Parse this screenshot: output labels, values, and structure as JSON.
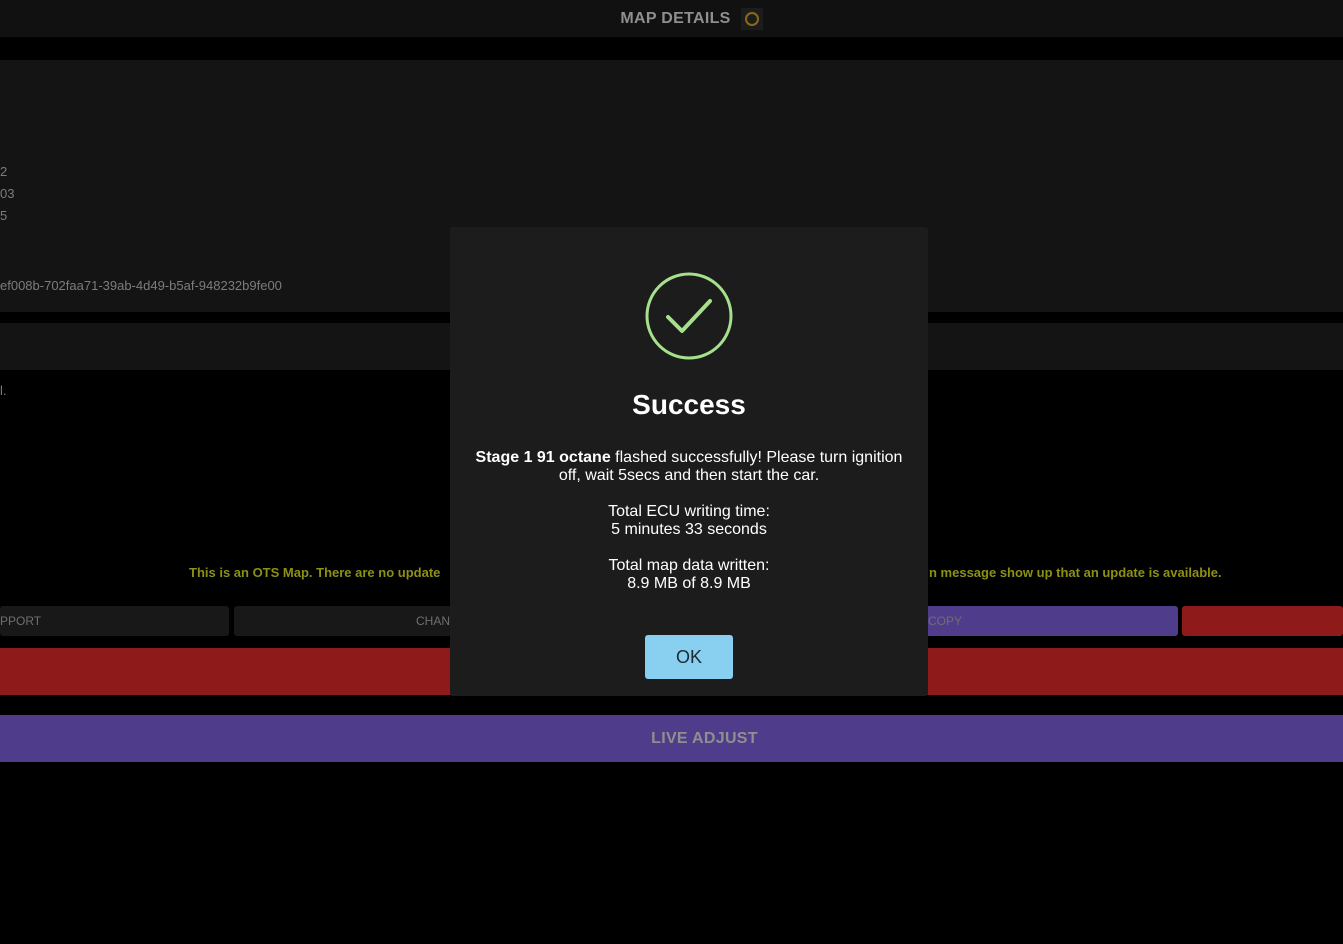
{
  "header": {
    "title": "MAP DETAILS",
    "icon": "loading-ring-icon"
  },
  "details": {
    "lines": [
      "2",
      "03",
      "5",
      "ef008b-702faa71-39ab-4d49-b5af-948232b9fe00"
    ]
  },
  "notes": {
    "small": "l.",
    "ots_left": "This is an OTS Map. There are no update",
    "ots_right": "n message show up that an update is available."
  },
  "buttons": {
    "support_label": "PPORT",
    "chan_label": "CHAN",
    "copy_label": "COPY",
    "live_adjust_label": "LIVE ADJUST"
  },
  "modal": {
    "icon": "check-circle-icon",
    "title": "Success",
    "map_name": "Stage 1 91 octane",
    "message_line1": " flashed successfully! Please turn ignition",
    "message_line2": "off, wait 5secs and then start the car.",
    "writing_time_label": "Total ECU writing time:",
    "writing_time_value": "5 minutes 33 seconds",
    "data_written_label": "Total map data written:",
    "data_written_value": "8.9 MB of 8.9 MB",
    "ok_label": "OK"
  },
  "colors": {
    "success_green": "#a6e08c",
    "ok_button": "#88cff0",
    "purple": "#4f3d8b",
    "red": "#8e1a1a",
    "ots_note": "#8c9114"
  }
}
